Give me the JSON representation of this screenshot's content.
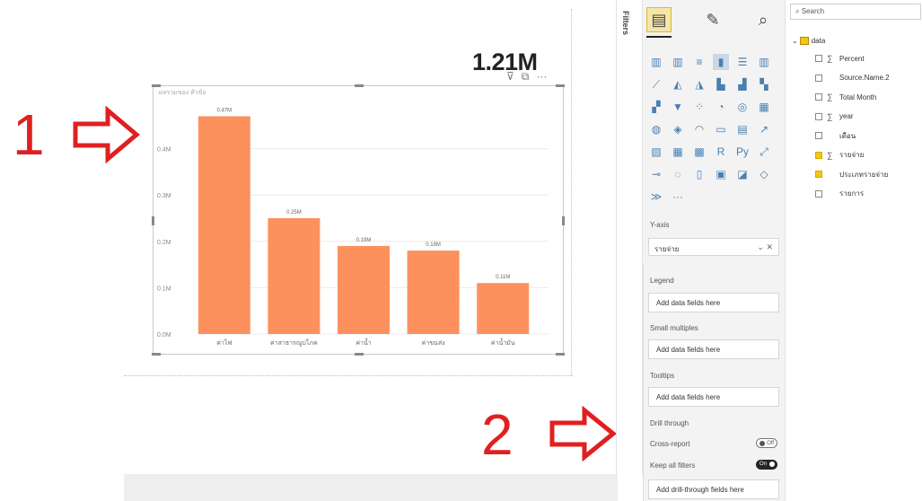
{
  "annotations": {
    "one": "1",
    "two": "2"
  },
  "kpi": "1.21M",
  "visual": {
    "title": "ผลรวมของ หัวข้อ",
    "header_icons": [
      "filter-icon",
      "focus-icon",
      "more-icon"
    ]
  },
  "chart_data": {
    "type": "bar",
    "categories": [
      "ค่าไฟ",
      "ค่าสาธารณูปโภค",
      "ค่าน้ำ",
      "ค่าขนส่ง",
      "ค่าน้ำมัน"
    ],
    "values": [
      0.47,
      0.25,
      0.19,
      0.18,
      0.11
    ],
    "data_labels": [
      "0.47M",
      "0.25M",
      "0.19M",
      "0.18M",
      "0.11M"
    ],
    "y_ticks": [
      "0.0M",
      "0.1M",
      "0.2M",
      "0.3M",
      "0.4M"
    ],
    "ylim": [
      0,
      0.5
    ],
    "bar_color": "#fc915e"
  },
  "filters_label": "Filters",
  "viz_pane": {
    "tabs": [
      "build-visual-icon",
      "format-icon",
      "analytics-icon"
    ],
    "y_axis_label": "Y-axis",
    "y_axis_field": "รายจ่าย",
    "legend_label": "Legend",
    "legend_placeholder": "Add data fields here",
    "small_multiples_label": "Small multiples",
    "small_multiples_placeholder": "Add data fields here",
    "tooltips_label": "Tooltips",
    "tooltips_placeholder": "Add data fields here",
    "drill_label": "Drill through",
    "cross_report_label": "Cross-report",
    "cross_report_state": "Off",
    "keep_filters_label": "Keep all filters",
    "keep_filters_state": "On",
    "drill_placeholder": "Add drill-through fields here",
    "more": "···"
  },
  "fields_pane": {
    "search_placeholder": "Search",
    "table_name": "data",
    "fields": [
      {
        "name": "Percent",
        "sigma": true,
        "checked": false
      },
      {
        "name": "Source.Name.2",
        "sigma": false,
        "checked": false
      },
      {
        "name": "Total Month",
        "sigma": true,
        "checked": false
      },
      {
        "name": "year",
        "sigma": true,
        "checked": false
      },
      {
        "name": "เดือน",
        "sigma": false,
        "checked": false
      },
      {
        "name": "รายจ่าย",
        "sigma": true,
        "checked": true
      },
      {
        "name": "ประเภทรายจ่าย",
        "sigma": false,
        "checked": true
      },
      {
        "name": "รายการ",
        "sigma": false,
        "checked": false
      }
    ]
  },
  "colors": {
    "annotation": "#e02020",
    "bar": "#fc915e",
    "checked": "#f2c811"
  }
}
